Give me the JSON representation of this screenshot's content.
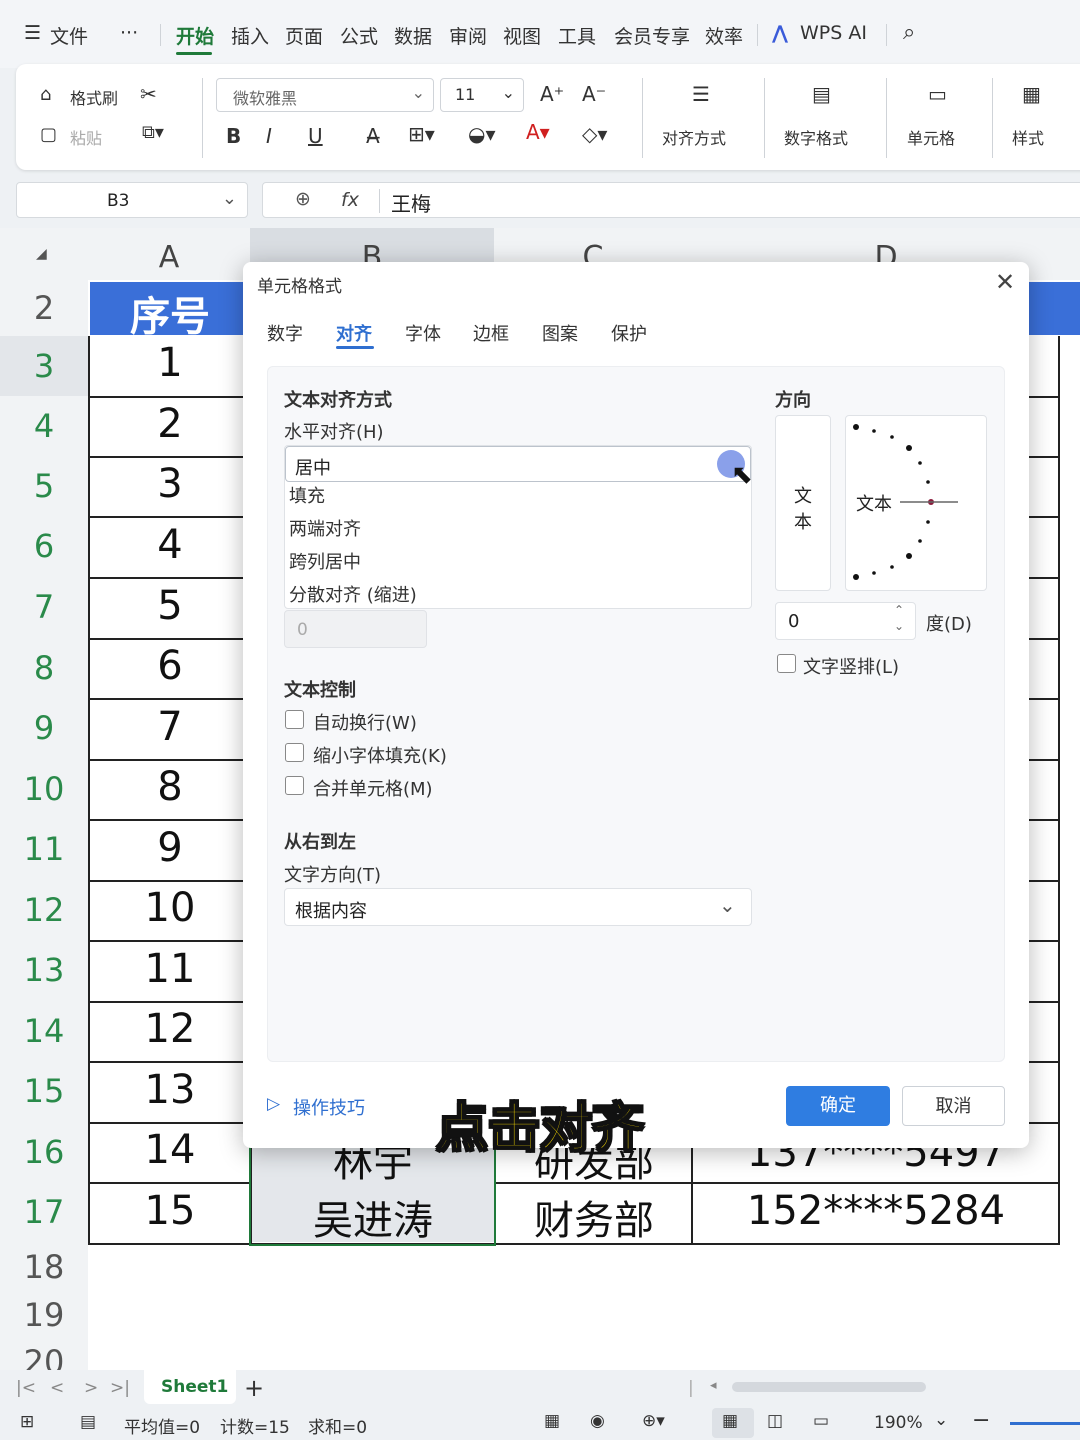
{
  "menu": {
    "items": [
      "文件",
      "···",
      "开始",
      "插入",
      "页面",
      "公式",
      "数据",
      "审阅",
      "视图",
      "工具",
      "会员专享",
      "效率",
      "WPS AI"
    ],
    "active": "开始"
  },
  "ribbon": {
    "format_painter": "格式刷",
    "paste": "粘贴",
    "font_name": "微软雅黑",
    "font_size": "11",
    "bold": "B",
    "italic": "I",
    "underline": "U",
    "align": "对齐方式",
    "number_format": "数字格式",
    "cell": "单元格",
    "style": "样式"
  },
  "formula_bar": {
    "name_box": "B3",
    "fx": "fx",
    "content": "王梅"
  },
  "columns": [
    "A",
    "B",
    "C",
    "D"
  ],
  "rows": {
    "numbers": [
      "2",
      "3",
      "4",
      "5",
      "6",
      "7",
      "8",
      "9",
      "10",
      "11",
      "12",
      "13",
      "14",
      "15",
      "16",
      "17",
      "18",
      "19",
      "20"
    ],
    "header_cell": "序号",
    "seq": [
      "1",
      "2",
      "3",
      "4",
      "5",
      "6",
      "7",
      "8",
      "9",
      "10",
      "11",
      "12",
      "13",
      "14",
      "15"
    ],
    "row16": {
      "name": "林宇",
      "dept": "研发部",
      "phone": "137****5497"
    },
    "row17": {
      "name": "吴进涛",
      "dept": "财务部",
      "phone": "152****5284"
    }
  },
  "dialog": {
    "title": "单元格格式",
    "tabs": [
      "数字",
      "对齐",
      "字体",
      "边框",
      "图案",
      "保护"
    ],
    "active_tab": "对齐",
    "text_align_section": "文本对齐方式",
    "horizontal_label": "水平对齐(H)",
    "horizontal_selected": "居中",
    "horizontal_options": [
      "填充",
      "两端对齐",
      "跨列居中",
      "分散对齐 (缩进)"
    ],
    "indent_value": "0",
    "text_control_section": "文本控制",
    "checkboxes": [
      "自动换行(W)",
      "缩小字体填充(K)",
      "合并单元格(M)"
    ],
    "rtl_section": "从右到左",
    "text_direction_label": "文字方向(T)",
    "text_direction_value": "根据内容",
    "orientation_section": "方向",
    "vertical_text": [
      "文",
      "本"
    ],
    "dial_text": "文本",
    "degree_value": "0",
    "degree_label": "度(D)",
    "vertical_text_checkbox": "文字竖排(L)",
    "tips": "操作技巧",
    "ok": "确定",
    "cancel": "取消"
  },
  "caption": "点击对齐",
  "sheet_tab": "Sheet1",
  "status": {
    "average": "平均值=0",
    "count": "计数=15",
    "sum": "求和=0",
    "zoom": "190%"
  },
  "colors": {
    "accent_green": "#1f7a3a",
    "header_blue": "#3a6fd8",
    "ok_blue": "#2f7de1",
    "caption_yellow": "#ffe100"
  }
}
